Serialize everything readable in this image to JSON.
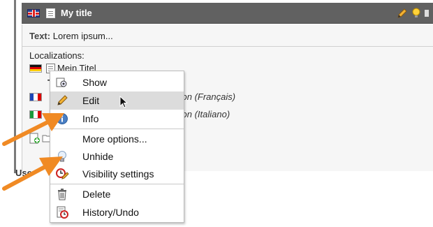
{
  "record": {
    "title": "My title",
    "text_label": "Text:",
    "text_value": "Lorem ipsum...",
    "localizations_label": "Localizations:",
    "de_title": "Mein Titel",
    "de_sub": "T",
    "fr_text": "tion (Français)",
    "it_text": "tion (Italiano)",
    "user_label": "Use"
  },
  "context_menu": {
    "items": [
      {
        "label": "Show",
        "icon": "show-icon"
      },
      {
        "label": "Edit",
        "icon": "pencil-icon"
      },
      {
        "label": "Info",
        "icon": "info-icon"
      },
      {
        "label": "More options...",
        "icon": ""
      },
      {
        "label": "Unhide",
        "icon": "lightbulb-icon"
      },
      {
        "label": "Visibility settings",
        "icon": "clock-pencil-icon"
      },
      {
        "label": "Delete",
        "icon": "trash-icon"
      },
      {
        "label": "History/Undo",
        "icon": "history-icon"
      }
    ],
    "active_item": "Edit"
  },
  "colors": {
    "header_bg": "#616161",
    "menu_highlight": "#dcdcdc",
    "arrow": "#f08a24"
  }
}
